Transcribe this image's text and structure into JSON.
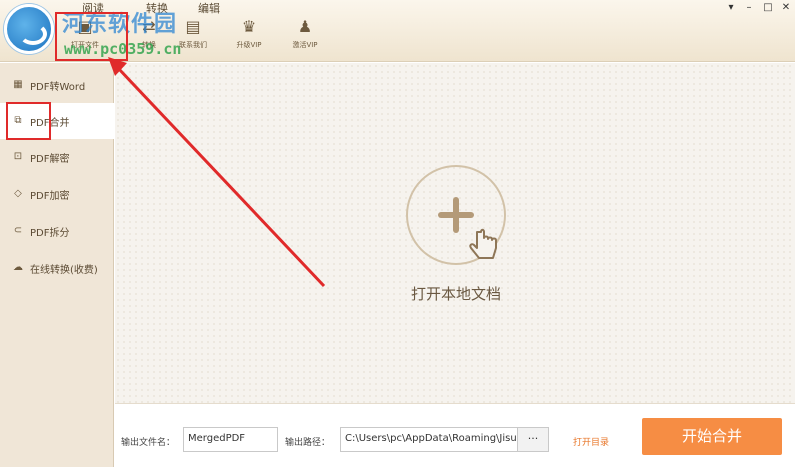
{
  "watermark": {
    "title": "河东软件园",
    "url": "www.pc0359.cn"
  },
  "menu": [
    {
      "label": "阅读"
    },
    {
      "label": "转换"
    },
    {
      "label": "编辑"
    }
  ],
  "toolbar": [
    {
      "label": "打开文件",
      "icon": "folder-icon"
    },
    {
      "label": "转换",
      "icon": "convert-icon"
    },
    {
      "label": "联系我们",
      "icon": "chat-icon"
    },
    {
      "label": "升级VIP",
      "icon": "crown-icon"
    },
    {
      "label": "激活VIP",
      "icon": "user-icon"
    }
  ],
  "sidebar": {
    "items": [
      {
        "label": "PDF转Word",
        "icon": "word-doc-icon"
      },
      {
        "label": "PDF合并",
        "icon": "merge-icon"
      },
      {
        "label": "PDF解密",
        "icon": "unlock-icon"
      },
      {
        "label": "PDF加密",
        "icon": "shield-icon"
      },
      {
        "label": "PDF拆分",
        "icon": "split-icon"
      },
      {
        "label": "在线转换(收费)",
        "icon": "cloud-icon"
      }
    ],
    "active": "PDF合并"
  },
  "main": {
    "open_label": "打开本地文档"
  },
  "bottom": {
    "output_name_label": "输出文件名：",
    "output_name_value": "MergedPDF",
    "output_path_label": "输出路径：",
    "output_path_value": "C:\\Users\\pc\\AppData\\Roaming\\Jisu",
    "browse_label": "···",
    "open_dir_label": "打开目录",
    "start_label": "开始合并"
  },
  "colors": {
    "accent": "#f68d44",
    "highlight": "#e02a2a",
    "sidebar_bg": "#f0e6d7"
  }
}
